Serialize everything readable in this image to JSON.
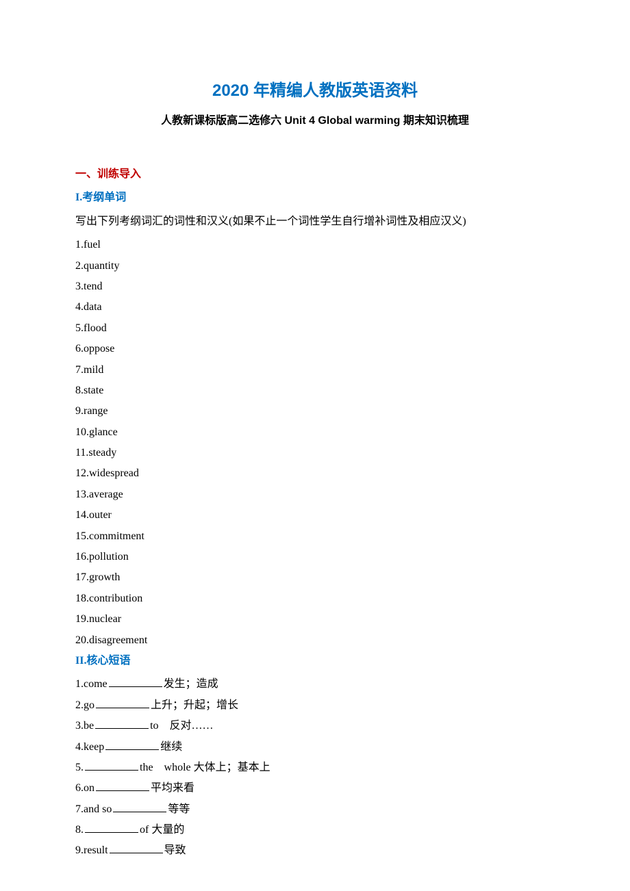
{
  "titles": {
    "main": "2020 年精编人教版英语资料",
    "sub": "人教新课标版高二选修六 Unit 4 Global warming 期末知识梳理"
  },
  "section1": {
    "header": "一、训练导入"
  },
  "vocab": {
    "header": "I.考纲单词",
    "instruction": "写出下列考纲词汇的词性和汉义(如果不止一个词性学生自行增补词性及相应汉义)",
    "items": [
      "1.fuel",
      "2.quantity",
      "3.tend",
      "4.data",
      "5.flood",
      "6.oppose",
      "7.mild",
      "8.state",
      "9.range",
      "10.glance",
      "11.steady",
      "12.widespread",
      "13.average",
      "14.outer",
      "15.commitment",
      "16.pollution",
      "17.growth",
      "18.contribution",
      "19.nuclear",
      "20.disagreement"
    ]
  },
  "phrases": {
    "header": "II.核心短语",
    "items": [
      {
        "num": "1.",
        "pre": "come",
        "post": "发生；造成"
      },
      {
        "num": "2.",
        "pre": "go",
        "post": "上升；升起；增长"
      },
      {
        "num": "3.",
        "pre": "be",
        "post": "to　反对……"
      },
      {
        "num": "4.",
        "pre": "keep",
        "post": "继续"
      },
      {
        "num": "5.",
        "pre": "",
        "post": "the　whole  大体上；基本上"
      },
      {
        "num": "6.",
        "pre": "on",
        "post": "平均来看"
      },
      {
        "num": "7.",
        "pre": "and so",
        "post": "等等"
      },
      {
        "num": "8.",
        "pre": "",
        "post": "of 大量的"
      },
      {
        "num": "9.",
        "pre": "result",
        "post": "导致"
      }
    ]
  }
}
